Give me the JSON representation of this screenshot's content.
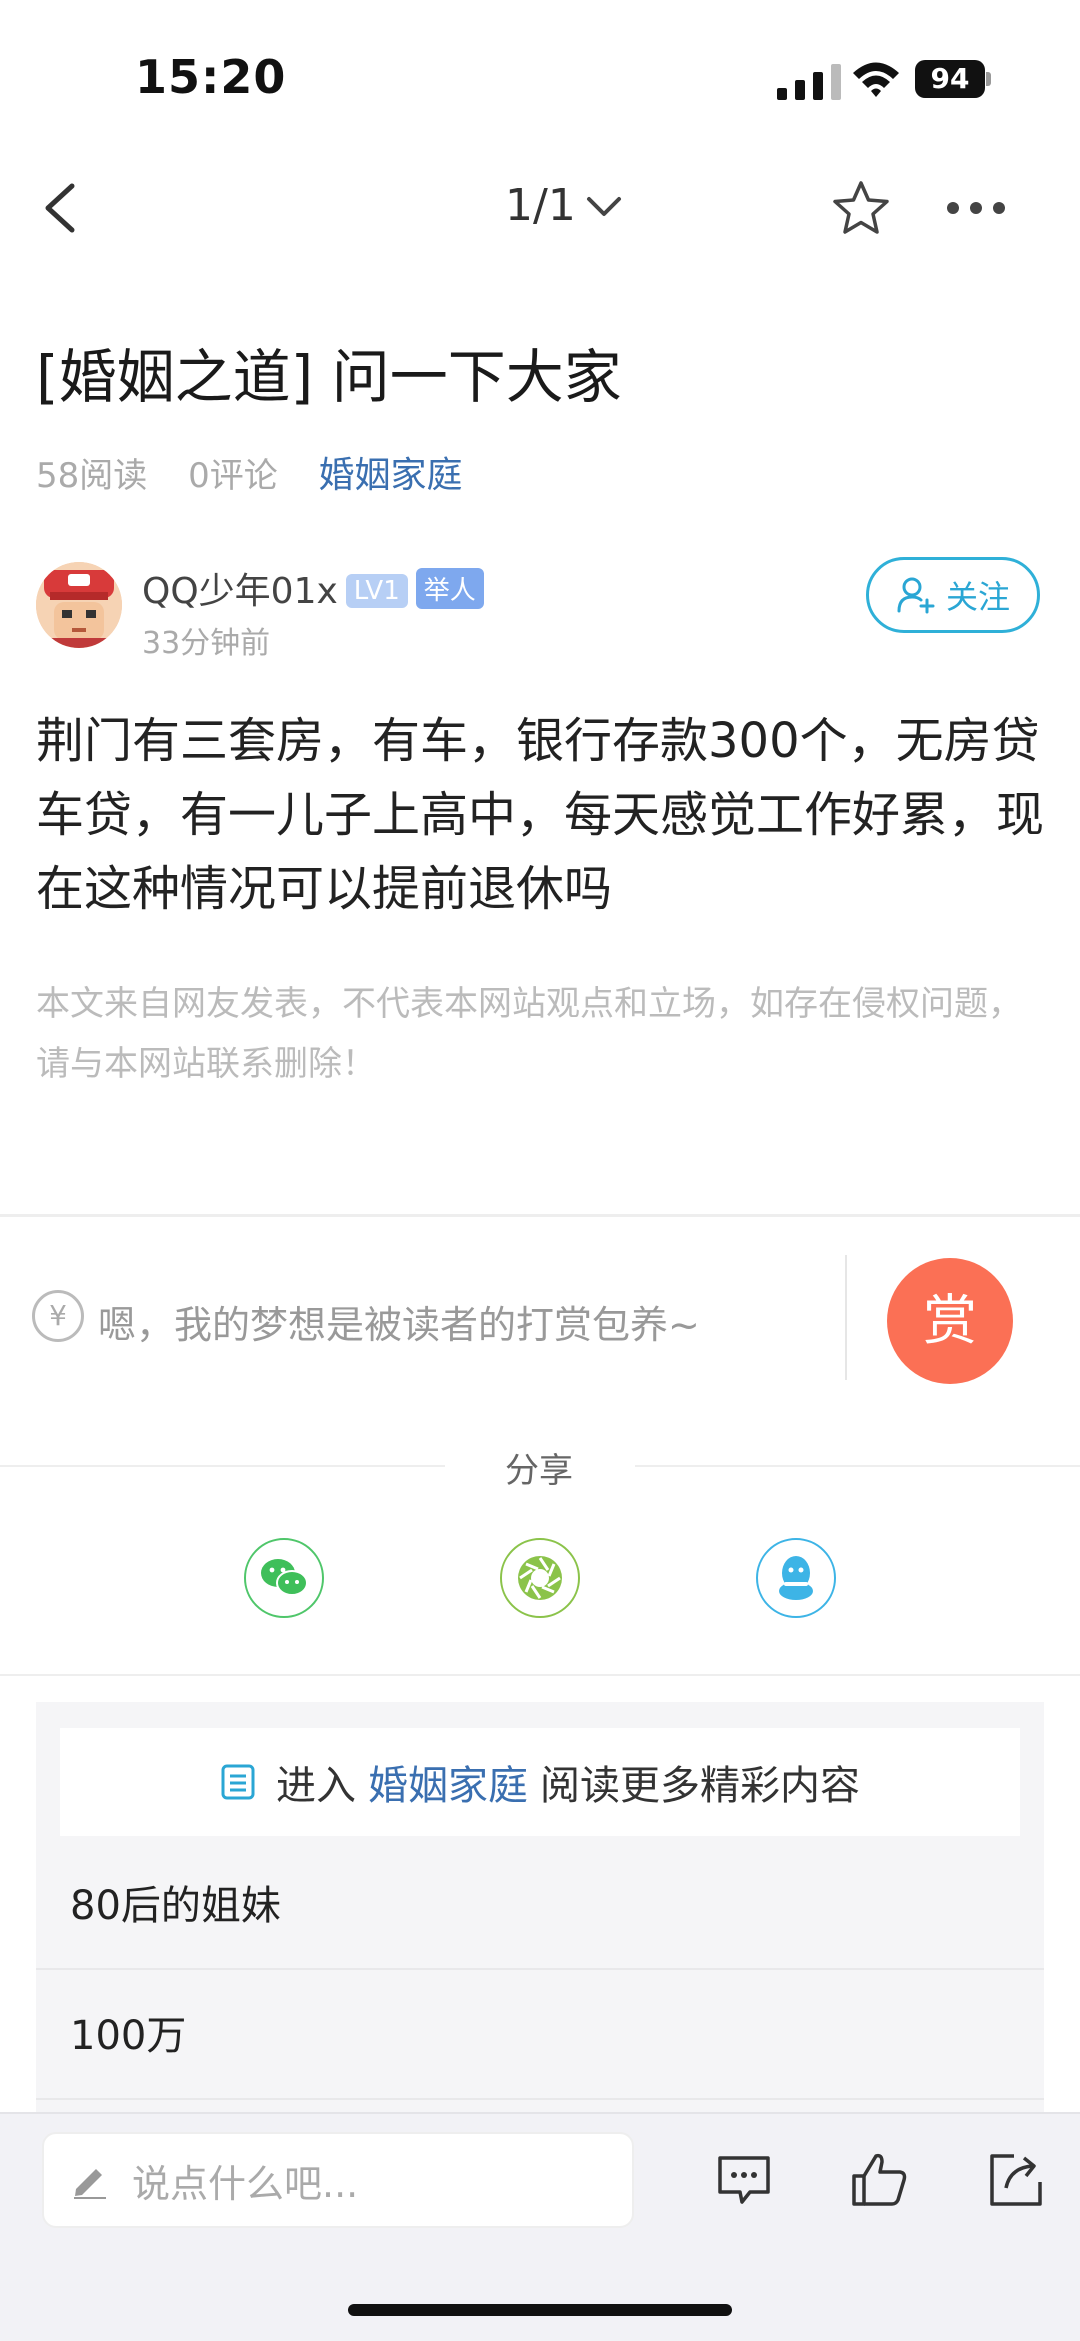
{
  "status": {
    "time": "15:20",
    "battery": "94"
  },
  "nav": {
    "page_indicator": "1/1"
  },
  "post": {
    "title": "[婚姻之道] 问一下大家",
    "reads": "58阅读",
    "comments": "0评论",
    "category": "婚姻家庭",
    "author": {
      "name": "QQ少年01x",
      "level": "LV1",
      "role": "举人",
      "time": "33分钟前"
    },
    "follow_label": "关注",
    "body": "荆门有三套房，有车，银行存款300个，无房贷车贷，有一儿子上高中，每天感觉工作好累，现在这种情况可以提前退休吗",
    "disclaimer": "本文来自网友发表，不代表本网站观点和立场，如存在侵权问题，请与本网站联系删除！"
  },
  "reward": {
    "icon_glyph": "¥",
    "prompt": "嗯，我的梦想是被读者的打赏包养~",
    "button_label": "赏"
  },
  "share": {
    "label": "分享",
    "targets": [
      "wechat-icon",
      "moments-icon",
      "qq-icon"
    ]
  },
  "related": {
    "enter_prefix": "进入",
    "enter_category": "婚姻家庭",
    "enter_suffix": "阅读更多精彩内容",
    "items": [
      "80后的姐妹",
      "100万"
    ]
  },
  "bottom_bar": {
    "comment_placeholder": "说点什么吧..."
  },
  "colors": {
    "accent_blue": "#3a6fb0",
    "follow_cyan": "#2aa6d4",
    "reward_orange": "#fb7055"
  }
}
